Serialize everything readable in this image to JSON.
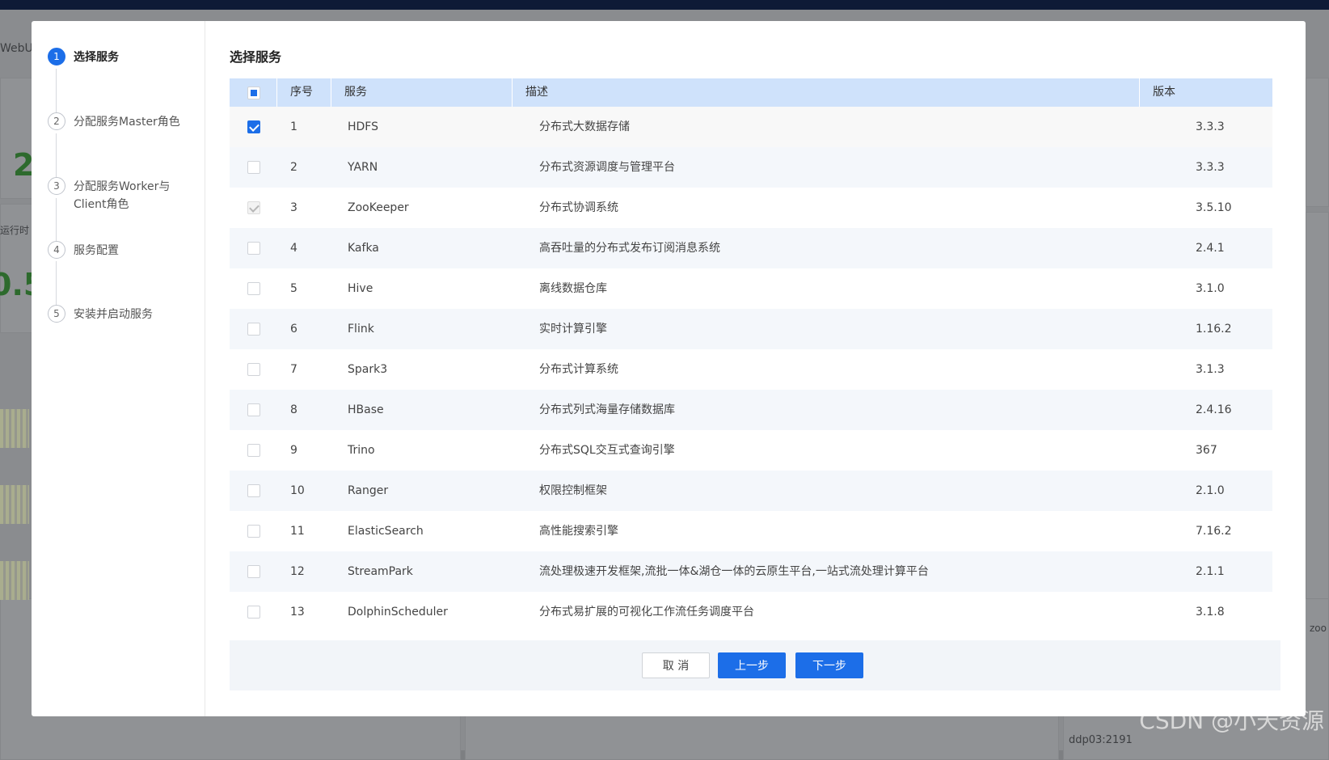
{
  "background": {
    "webui_label": "WebUI",
    "big_number_1": "2",
    "runtime_label": "运行时",
    "big_number_2": "0.5",
    "right_label": "zoo",
    "host_label": "ddp03:2191",
    "watermark": "CSDN @小天资源"
  },
  "steps": [
    {
      "num": "1",
      "label": "选择服务"
    },
    {
      "num": "2",
      "label": "分配服务Master角色"
    },
    {
      "num": "3",
      "label": "分配服务Worker与Client角色"
    },
    {
      "num": "4",
      "label": "服务配置"
    },
    {
      "num": "5",
      "label": "安装并启动服务"
    }
  ],
  "content": {
    "title": "选择服务",
    "columns": {
      "no": "序号",
      "service": "服务",
      "description": "描述",
      "version": "版本"
    },
    "rows": [
      {
        "no": "1",
        "service": "HDFS",
        "description": "分布式大数据存储",
        "version": "3.3.3",
        "state": "checked"
      },
      {
        "no": "2",
        "service": "YARN",
        "description": "分布式资源调度与管理平台",
        "version": "3.3.3",
        "state": "unchecked"
      },
      {
        "no": "3",
        "service": "ZooKeeper",
        "description": "分布式协调系统",
        "version": "3.5.10",
        "state": "disabled"
      },
      {
        "no": "4",
        "service": "Kafka",
        "description": "高吞吐量的分布式发布订阅消息系统",
        "version": "2.4.1",
        "state": "unchecked"
      },
      {
        "no": "5",
        "service": "Hive",
        "description": "离线数据仓库",
        "version": "3.1.0",
        "state": "unchecked"
      },
      {
        "no": "6",
        "service": "Flink",
        "description": "实时计算引擎",
        "version": "1.16.2",
        "state": "unchecked"
      },
      {
        "no": "7",
        "service": "Spark3",
        "description": "分布式计算系统",
        "version": "3.1.3",
        "state": "unchecked"
      },
      {
        "no": "8",
        "service": "HBase",
        "description": "分布式列式海量存储数据库",
        "version": "2.4.16",
        "state": "unchecked"
      },
      {
        "no": "9",
        "service": "Trino",
        "description": "分布式SQL交互式查询引擎",
        "version": "367",
        "state": "unchecked"
      },
      {
        "no": "10",
        "service": "Ranger",
        "description": "权限控制框架",
        "version": "2.1.0",
        "state": "unchecked"
      },
      {
        "no": "11",
        "service": "ElasticSearch",
        "description": "高性能搜索引擎",
        "version": "7.16.2",
        "state": "unchecked"
      },
      {
        "no": "12",
        "service": "StreamPark",
        "description": "流处理极速开发框架,流批一体&湖仓一体的云原生平台,一站式流处理计算平台",
        "version": "2.1.1",
        "state": "unchecked"
      },
      {
        "no": "13",
        "service": "DolphinScheduler",
        "description": "分布式易扩展的可视化工作流任务调度平台",
        "version": "3.1.8",
        "state": "unchecked"
      }
    ]
  },
  "footer": {
    "cancel_label": "取 消",
    "prev_label": "上一步",
    "next_label": "下一步"
  },
  "colors": {
    "accent": "#1c6ee8",
    "header_bg": "#cfe2fb"
  }
}
